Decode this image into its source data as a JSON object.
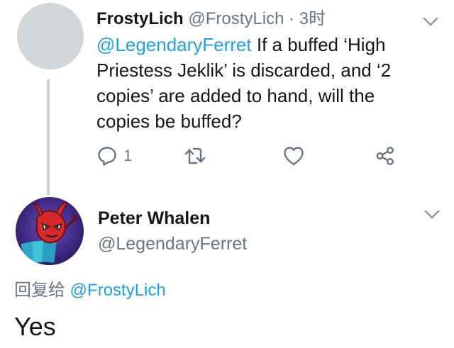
{
  "tweet1": {
    "display_name": "FrostyLich",
    "handle": "@FrostyLich",
    "separator": "·",
    "time": "3时",
    "mention": "@LegendaryFerret",
    "text": " If a buffed ‘High Priestess Jeklik’ is discarded, and ‘2 copies’ are added to hand, will the copies be buffed?",
    "reply_count": "1",
    "icons": {
      "reply": "reply-icon",
      "retweet": "retweet-icon",
      "like": "heart-icon",
      "share": "share-icon",
      "menu": "chevron-down-icon"
    }
  },
  "tweet2": {
    "display_name": "Peter Whalen",
    "handle": "@LegendaryFerret",
    "reply_to_prefix": "回复给 ",
    "reply_to_handle": "@FrostyLich",
    "text": "Yes"
  },
  "colors": {
    "accent": "#1da1f2",
    "secondary_text": "#657786",
    "primary_text": "#14171a",
    "thread_line": "#c4cfd6"
  }
}
